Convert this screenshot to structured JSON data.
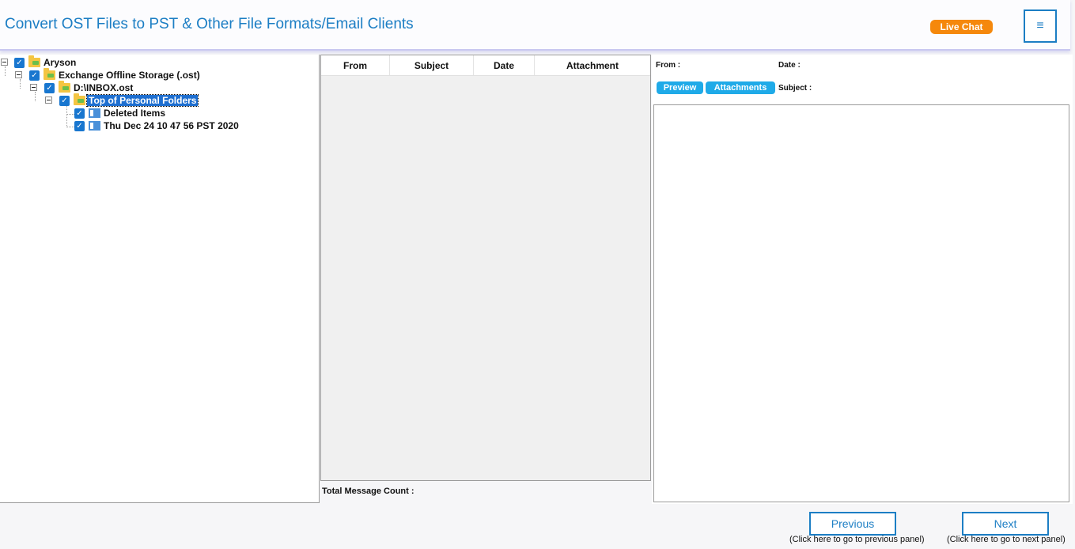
{
  "header": {
    "title": "Convert OST Files to PST & Other File Formats/Email Clients",
    "live_chat": "Live Chat",
    "menu_icon": "≡"
  },
  "tree": {
    "nodes": [
      {
        "label": "Aryson",
        "checked": true,
        "icon": "folder-icon"
      },
      {
        "label": "Exchange Offline Storage (.ost)",
        "checked": true,
        "icon": "folder-icon"
      },
      {
        "label": "D:\\INBOX.ost",
        "checked": true,
        "icon": "folder-icon"
      },
      {
        "label": "Top of Personal Folders",
        "checked": true,
        "icon": "folder-icon",
        "selected": true
      },
      {
        "label": "Deleted Items",
        "checked": true,
        "icon": "mail-folder-icon"
      },
      {
        "label": "Thu Dec 24 10 47 56 PST 2020",
        "checked": true,
        "icon": "mail-folder-icon"
      }
    ],
    "check_mark": "✓"
  },
  "message_list": {
    "columns": [
      "From",
      "Subject",
      "Date",
      "Attachment"
    ],
    "rows": [],
    "total_label": "Total Message Count :"
  },
  "preview": {
    "from_label": "From :",
    "date_label": "Date :",
    "subject_label": "Subject :",
    "tabs": [
      "Preview",
      "Attachments"
    ]
  },
  "footer": {
    "previous_label": "Previous",
    "previous_hint": "(Click here to go to previous panel)",
    "next_label": "Next",
    "next_hint": "(Click here to go to next panel)"
  },
  "colors": {
    "accent": "#1c7ec4",
    "live_chat": "#f5880c",
    "tab": "#1faae8",
    "checkbox": "#1876cf"
  }
}
